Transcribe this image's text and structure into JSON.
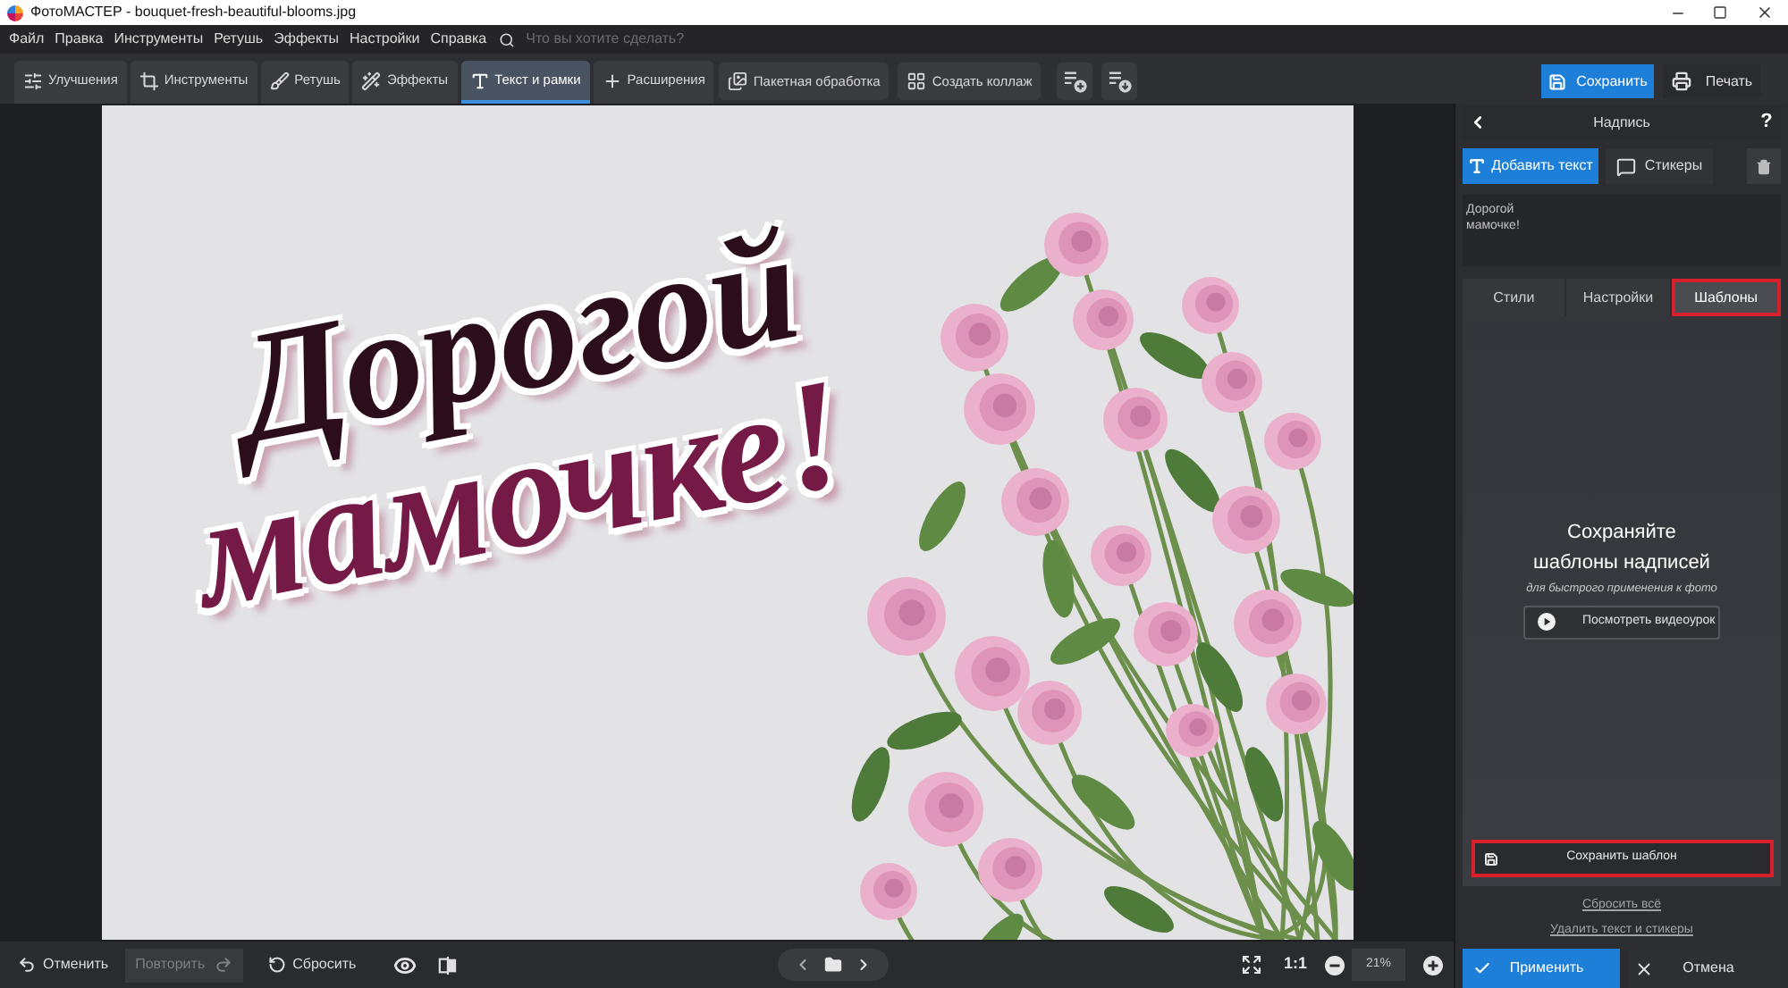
{
  "window": {
    "title": "ФотоМАСТЕР - bouquet-fresh-beautiful-blooms.jpg"
  },
  "menu": {
    "items": [
      "Файл",
      "Правка",
      "Инструменты",
      "Ретушь",
      "Эффекты",
      "Настройки",
      "Справка"
    ],
    "search": {
      "placeholder": "Что вы хотите сделать?"
    }
  },
  "toolbar": {
    "tabs": [
      {
        "label": "Улучшения",
        "selected": false
      },
      {
        "label": "Инструменты",
        "selected": false
      },
      {
        "label": "Ретушь",
        "selected": false
      },
      {
        "label": "Эффекты",
        "selected": false
      },
      {
        "label": "Текст и рамки",
        "selected": true
      },
      {
        "label": "Расширения",
        "selected": false
      }
    ],
    "actions": [
      "Пакетная обработка",
      "Создать коллаж"
    ],
    "save_button": "Сохранить",
    "print_button": "Печать"
  },
  "canvas": {
    "text_layer": [
      "Дорогой",
      "мамочке!"
    ]
  },
  "panel": {
    "title": "Надпись",
    "help": "?",
    "add_text_button": "Добавить текст",
    "stickers_button": "Стикеры",
    "text_value": "Дорогой\nмамочке!",
    "tabs": [
      {
        "label": "Стили",
        "selected": false,
        "highlighted": false
      },
      {
        "label": "Настройки",
        "selected": false,
        "highlighted": false
      },
      {
        "label": "Шаблоны",
        "selected": true,
        "highlighted": true
      }
    ],
    "empty_state": {
      "heading": "Сохраняйте\nшаблоны надписей",
      "subtitle": "для быстрого применения к фото",
      "video_button": "Посмотреть видеоурок"
    },
    "save_template_button": {
      "label": "Сохранить шаблон",
      "highlighted": true
    },
    "links": [
      "Сбросить всё",
      "Удалить текст и стикеры"
    ],
    "apply_button": "Применить",
    "cancel_button": "Отмена"
  },
  "bottom_bar": {
    "undo": {
      "label": "Отменить",
      "disabled": false
    },
    "redo": {
      "label": "Повторить",
      "disabled": true
    },
    "reset": "Сбросить",
    "zoom_ratio": "1:1",
    "zoom_value": "21%"
  }
}
